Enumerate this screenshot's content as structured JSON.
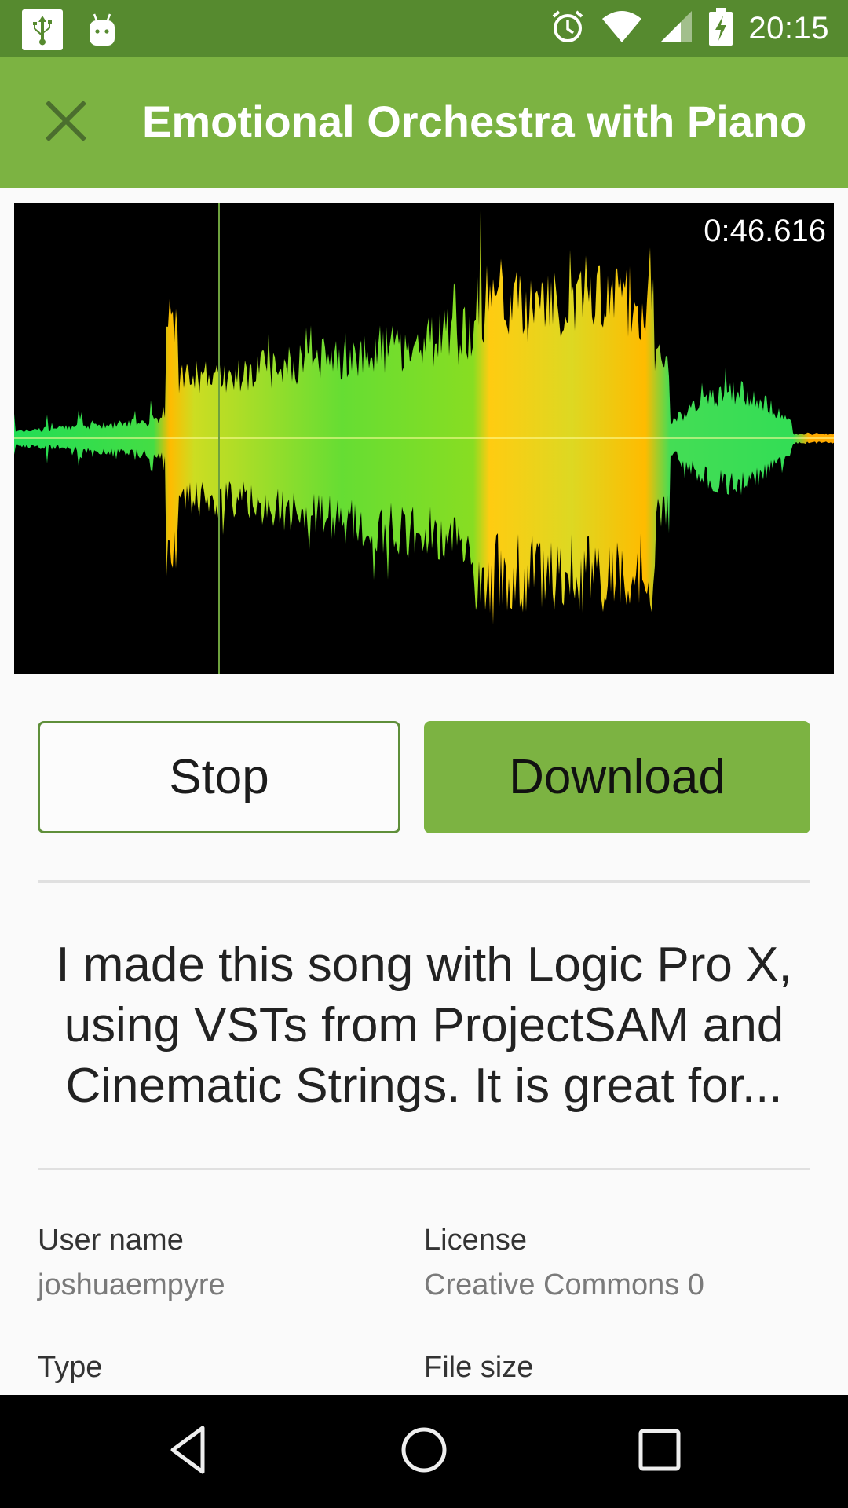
{
  "status_bar": {
    "time": "20:15",
    "left_icons": [
      "usb-icon",
      "android-debug-icon"
    ],
    "right_icons": [
      "alarm-icon",
      "wifi-icon",
      "cell-signal-icon",
      "battery-charging-icon"
    ],
    "color": "#568a2f"
  },
  "app_bar": {
    "title": "Emotional Orchestra with Piano",
    "close_icon": "close-icon",
    "color": "#7cb342"
  },
  "player": {
    "current_time": "0:46.616",
    "playhead_fraction": 0.25,
    "waveform_colors": {
      "low": "#22dd55",
      "mid": "#aadd22",
      "high": "#ffcc00"
    }
  },
  "actions": {
    "stop_label": "Stop",
    "download_label": "Download"
  },
  "description": "I made this song with Logic Pro X, using VSTs from ProjectSAM and Cinematic Strings. It is great for...",
  "details": {
    "user_name_label": "User name",
    "user_name_value": "joshuaempyre",
    "license_label": "License",
    "license_value": "Creative Commons 0",
    "type_label": "Type",
    "file_size_label": "File size"
  },
  "nav_bar": {
    "back_icon": "back-icon",
    "home_icon": "home-icon",
    "recents_icon": "recents-icon"
  }
}
